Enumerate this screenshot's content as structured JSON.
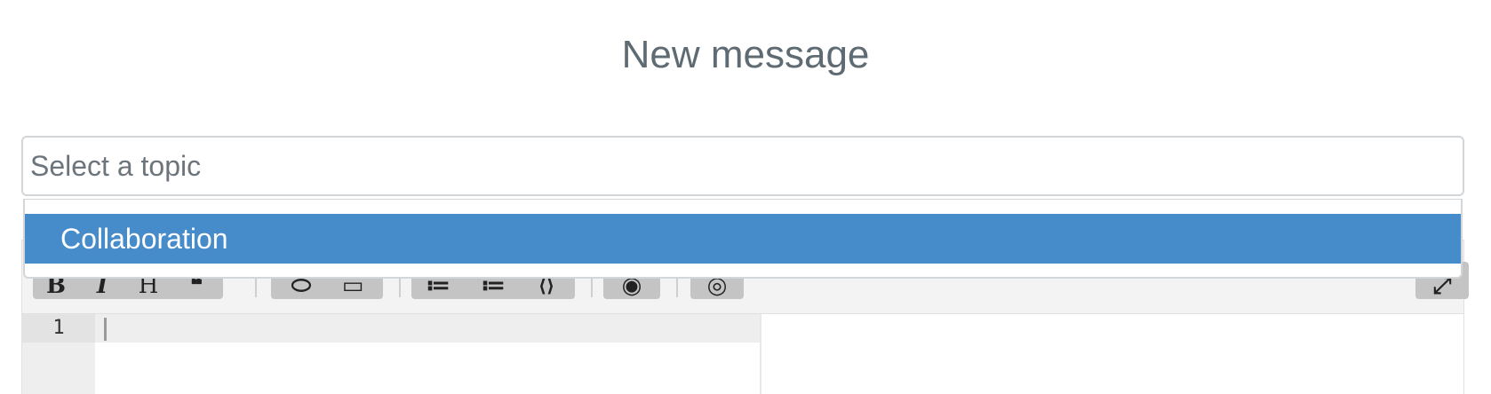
{
  "page": {
    "title": "New message"
  },
  "topic_select": {
    "placeholder": "Select a topic",
    "options": [
      {
        "label": "Collaboration",
        "highlighted": true
      }
    ]
  },
  "editor": {
    "toolbar": {
      "groups": [
        {
          "buttons": [
            {
              "name": "bold",
              "glyph": "B"
            },
            {
              "name": "italic",
              "glyph": "I"
            },
            {
              "name": "heading",
              "glyph": "H"
            },
            {
              "name": "quote",
              "glyph": "❝"
            }
          ]
        },
        {
          "buttons": [
            {
              "name": "link",
              "glyph": "⬭"
            },
            {
              "name": "image",
              "glyph": "▭"
            }
          ]
        },
        {
          "buttons": [
            {
              "name": "unordered-list",
              "glyph": "≔"
            },
            {
              "name": "ordered-list",
              "glyph": "≔"
            },
            {
              "name": "code",
              "glyph": "⟨⟩"
            }
          ]
        },
        {
          "buttons": [
            {
              "name": "preview",
              "glyph": "◉"
            }
          ]
        },
        {
          "buttons": [
            {
              "name": "side-by-side",
              "glyph": "◎"
            }
          ]
        },
        {
          "buttons": [
            {
              "name": "fullscreen",
              "glyph": "⤢"
            }
          ]
        }
      ]
    },
    "line_number": "1"
  },
  "colors": {
    "highlight": "#468ccb",
    "title": "#5f6b73",
    "placeholder": "#6d757c",
    "toolbar_button": "#c4c4c4"
  }
}
